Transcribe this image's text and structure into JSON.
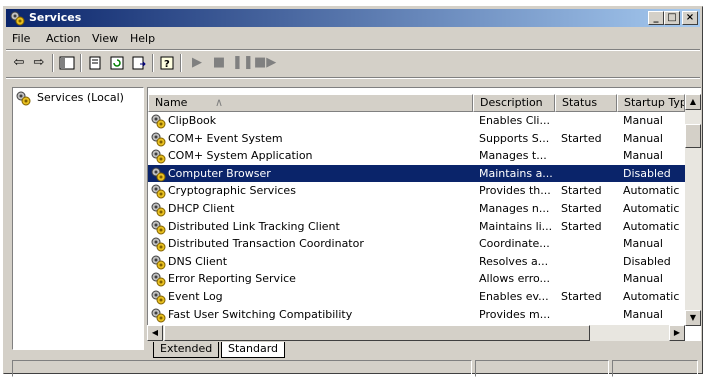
{
  "window": {
    "title": "Services",
    "controls": {
      "minimize": "_",
      "maximize": "□",
      "close": "×"
    }
  },
  "menubar": [
    {
      "label": "File"
    },
    {
      "label": "Action"
    },
    {
      "label": "View"
    },
    {
      "label": "Help"
    }
  ],
  "toolbar": {
    "icons": [
      "back-icon",
      "forward-icon",
      "show-hide-tree-icon",
      "properties-icon",
      "refresh-icon",
      "export-list-icon",
      "help-icon",
      "start-service-icon",
      "stop-service-icon",
      "pause-service-icon",
      "restart-service-icon"
    ]
  },
  "tree": {
    "root_label": "Services (Local)"
  },
  "list": {
    "columns": [
      "Name",
      "Description",
      "Status",
      "Startup Typ"
    ],
    "rows": [
      {
        "name": "ClipBook",
        "description": "Enables Cli...",
        "status": "",
        "startup": "Manual"
      },
      {
        "name": "COM+ Event System",
        "description": "Supports S...",
        "status": "Started",
        "startup": "Manual"
      },
      {
        "name": "COM+ System Application",
        "description": "Manages t...",
        "status": "",
        "startup": "Manual"
      },
      {
        "name": "Computer Browser",
        "description": "Maintains a...",
        "status": "",
        "startup": "Disabled"
      },
      {
        "name": "Cryptographic Services",
        "description": "Provides th...",
        "status": "Started",
        "startup": "Automatic"
      },
      {
        "name": "DHCP Client",
        "description": "Manages n...",
        "status": "Started",
        "startup": "Automatic"
      },
      {
        "name": "Distributed Link Tracking Client",
        "description": "Maintains li...",
        "status": "Started",
        "startup": "Automatic"
      },
      {
        "name": "Distributed Transaction Coordinator",
        "description": "Coordinate...",
        "status": "",
        "startup": "Manual"
      },
      {
        "name": "DNS Client",
        "description": "Resolves a...",
        "status": "",
        "startup": "Disabled"
      },
      {
        "name": "Error Reporting Service",
        "description": "Allows erro...",
        "status": "",
        "startup": "Manual"
      },
      {
        "name": "Event Log",
        "description": "Enables ev...",
        "status": "Started",
        "startup": "Automatic"
      },
      {
        "name": "Fast User Switching Compatibility",
        "description": "Provides m...",
        "status": "",
        "startup": "Manual"
      }
    ]
  },
  "tabs": [
    "Extended",
    "Standard"
  ],
  "colors": {
    "selection": "#0a246a",
    "titlebar_start": "#0a246a",
    "titlebar_end": "#a6caf0",
    "face": "#d4d0c8"
  }
}
